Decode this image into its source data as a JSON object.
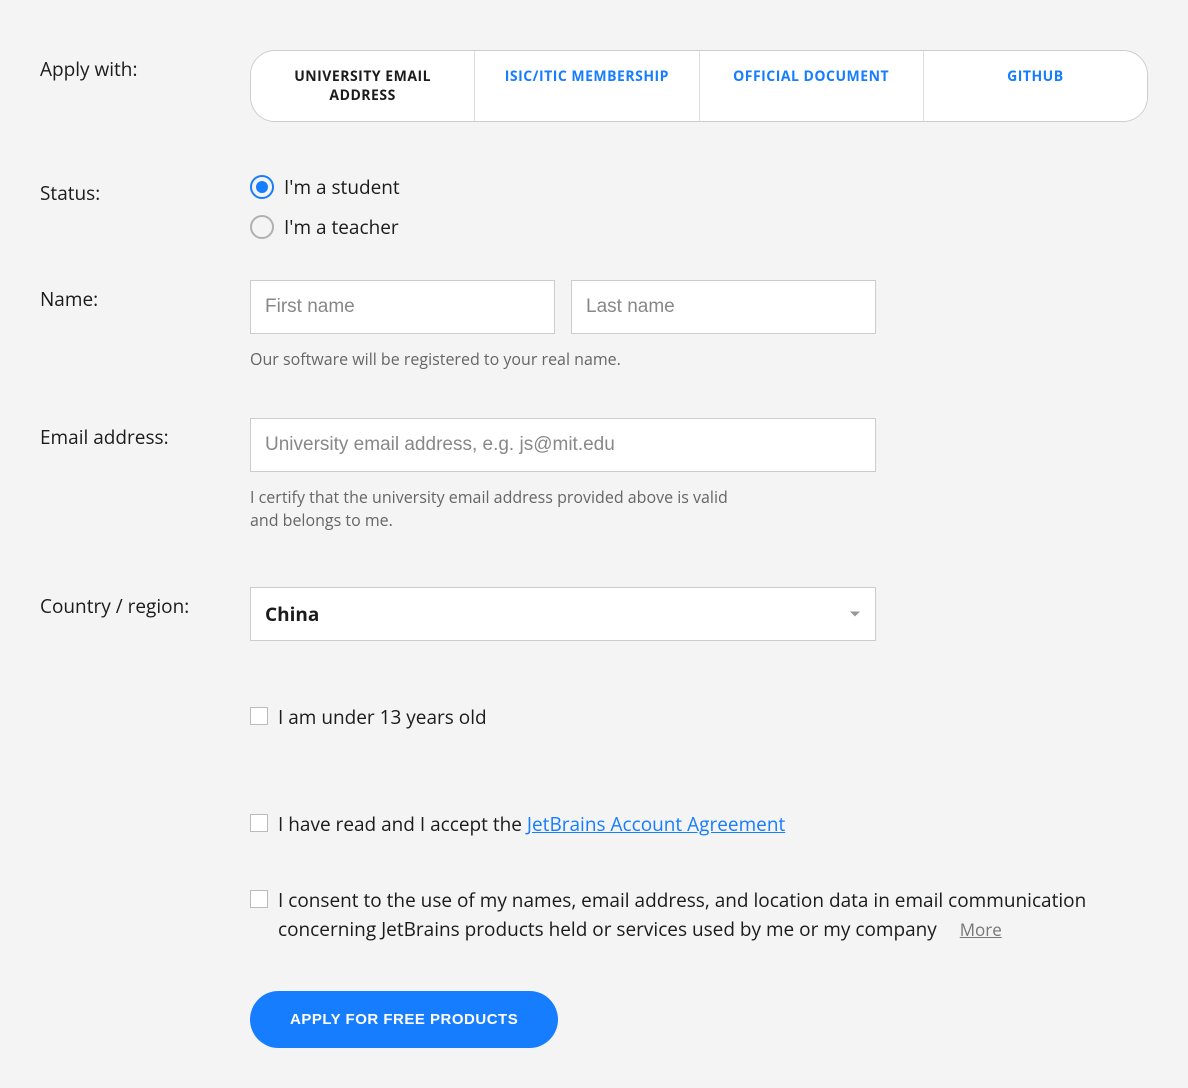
{
  "labels": {
    "apply_with": "Apply with:",
    "status": "Status:",
    "name": "Name:",
    "email": "Email address:",
    "country": "Country / region:"
  },
  "tabs": {
    "university": "UNIVERSITY EMAIL ADDRESS",
    "isic": "ISIC/ITIC MEMBERSHIP",
    "official": "OFFICIAL DOCUMENT",
    "github": "GITHUB"
  },
  "status_options": {
    "student": "I'm a student",
    "teacher": "I'm a teacher"
  },
  "name_fields": {
    "first_placeholder": "First name",
    "last_placeholder": "Last name",
    "helper": "Our software will be registered to your real name."
  },
  "email_field": {
    "placeholder": "University email address, e.g. js@mit.edu",
    "helper": "I certify that the university email address provided above is valid and belongs to me."
  },
  "country_field": {
    "selected": "China"
  },
  "checkboxes": {
    "under13": "I am under 13 years old",
    "accept_prefix": "I have read and I accept the ",
    "accept_link": "JetBrains Account Agreement",
    "consent": "I consent to the use of my names, email address, and location data in email communication concerning JetBrains products held or services used by me or my company",
    "more": "More"
  },
  "submit": {
    "label": "APPLY FOR FREE PRODUCTS"
  }
}
